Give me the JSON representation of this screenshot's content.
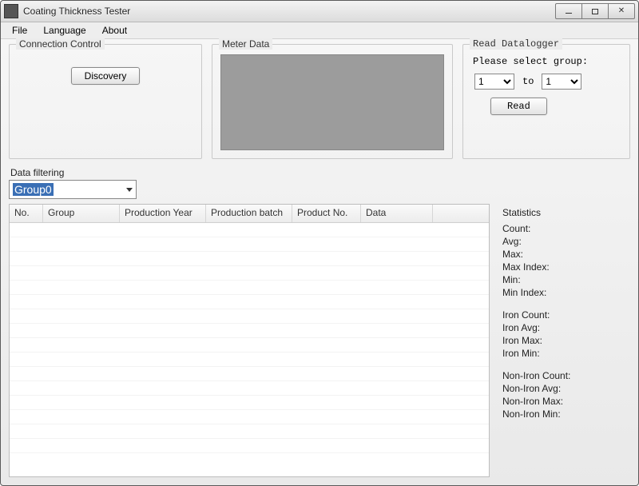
{
  "window": {
    "title": "Coating Thickness Tester"
  },
  "menu": {
    "file": "File",
    "language": "Language",
    "about": "About"
  },
  "connection": {
    "legend": "Connection Control",
    "discovery_label": "Discovery"
  },
  "meter": {
    "legend": "Meter Data"
  },
  "datalogger": {
    "legend": "Read Datalogger",
    "prompt": "Please select group:",
    "from_value": "1",
    "to_label": "to",
    "to_value": "1",
    "read_label": "Read"
  },
  "filter": {
    "label": "Data filtering",
    "selected": "Group0"
  },
  "table": {
    "columns": {
      "no": "No.",
      "group": "Group",
      "year": "Production Year",
      "batch": "Production batch",
      "product": "Product No.",
      "data": "Data"
    }
  },
  "stats": {
    "header": "Statistics",
    "count": "Count:",
    "avg": "Avg:",
    "max": "Max:",
    "max_index": "Max Index:",
    "min": "Min:",
    "min_index": "Min Index:",
    "iron_count": "Iron Count:",
    "iron_avg": "Iron Avg:",
    "iron_max": "Iron Max:",
    "iron_min": "Iron Min:",
    "non_iron_count": "Non-Iron Count:",
    "non_iron_avg": "Non-Iron Avg:",
    "non_iron_max": "Non-Iron Max:",
    "non_iron_min": "Non-Iron Min:"
  }
}
